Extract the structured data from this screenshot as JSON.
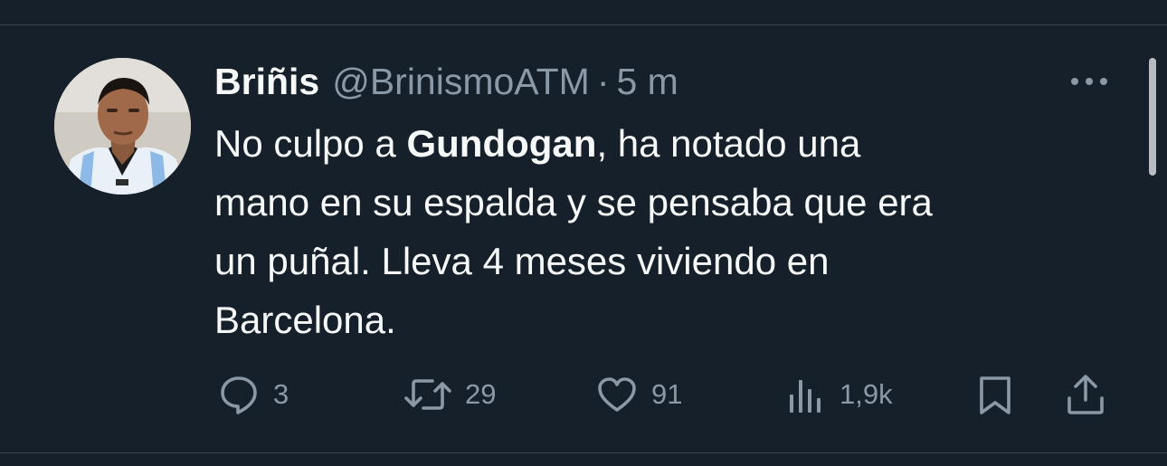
{
  "tweet": {
    "author": {
      "display_name": "Briñis",
      "handle": "@BrinismoATM",
      "separator": "·",
      "time": "5 m"
    },
    "text": {
      "line1_pre": "No culpo a ",
      "line1_bold": "Gundogan",
      "line1_post": ", ha notado una",
      "line2": "mano en su espalda y se pensaba que era",
      "line3": "un puñal. Lleva 4 meses viviendo en",
      "line4": "Barcelona."
    },
    "metrics": {
      "replies": "3",
      "retweets": "29",
      "likes": "91",
      "views": "1,9k"
    },
    "icons": {
      "reply": "reply-icon",
      "retweet": "retweet-icon",
      "like": "heart-icon",
      "views": "views-icon",
      "bookmark": "bookmark-icon",
      "share": "share-icon",
      "more": "more-icon"
    }
  },
  "theme": {
    "background": "#15202b",
    "text": "#f7f9f9",
    "muted": "#8b98a5",
    "divider": "#38444d"
  }
}
